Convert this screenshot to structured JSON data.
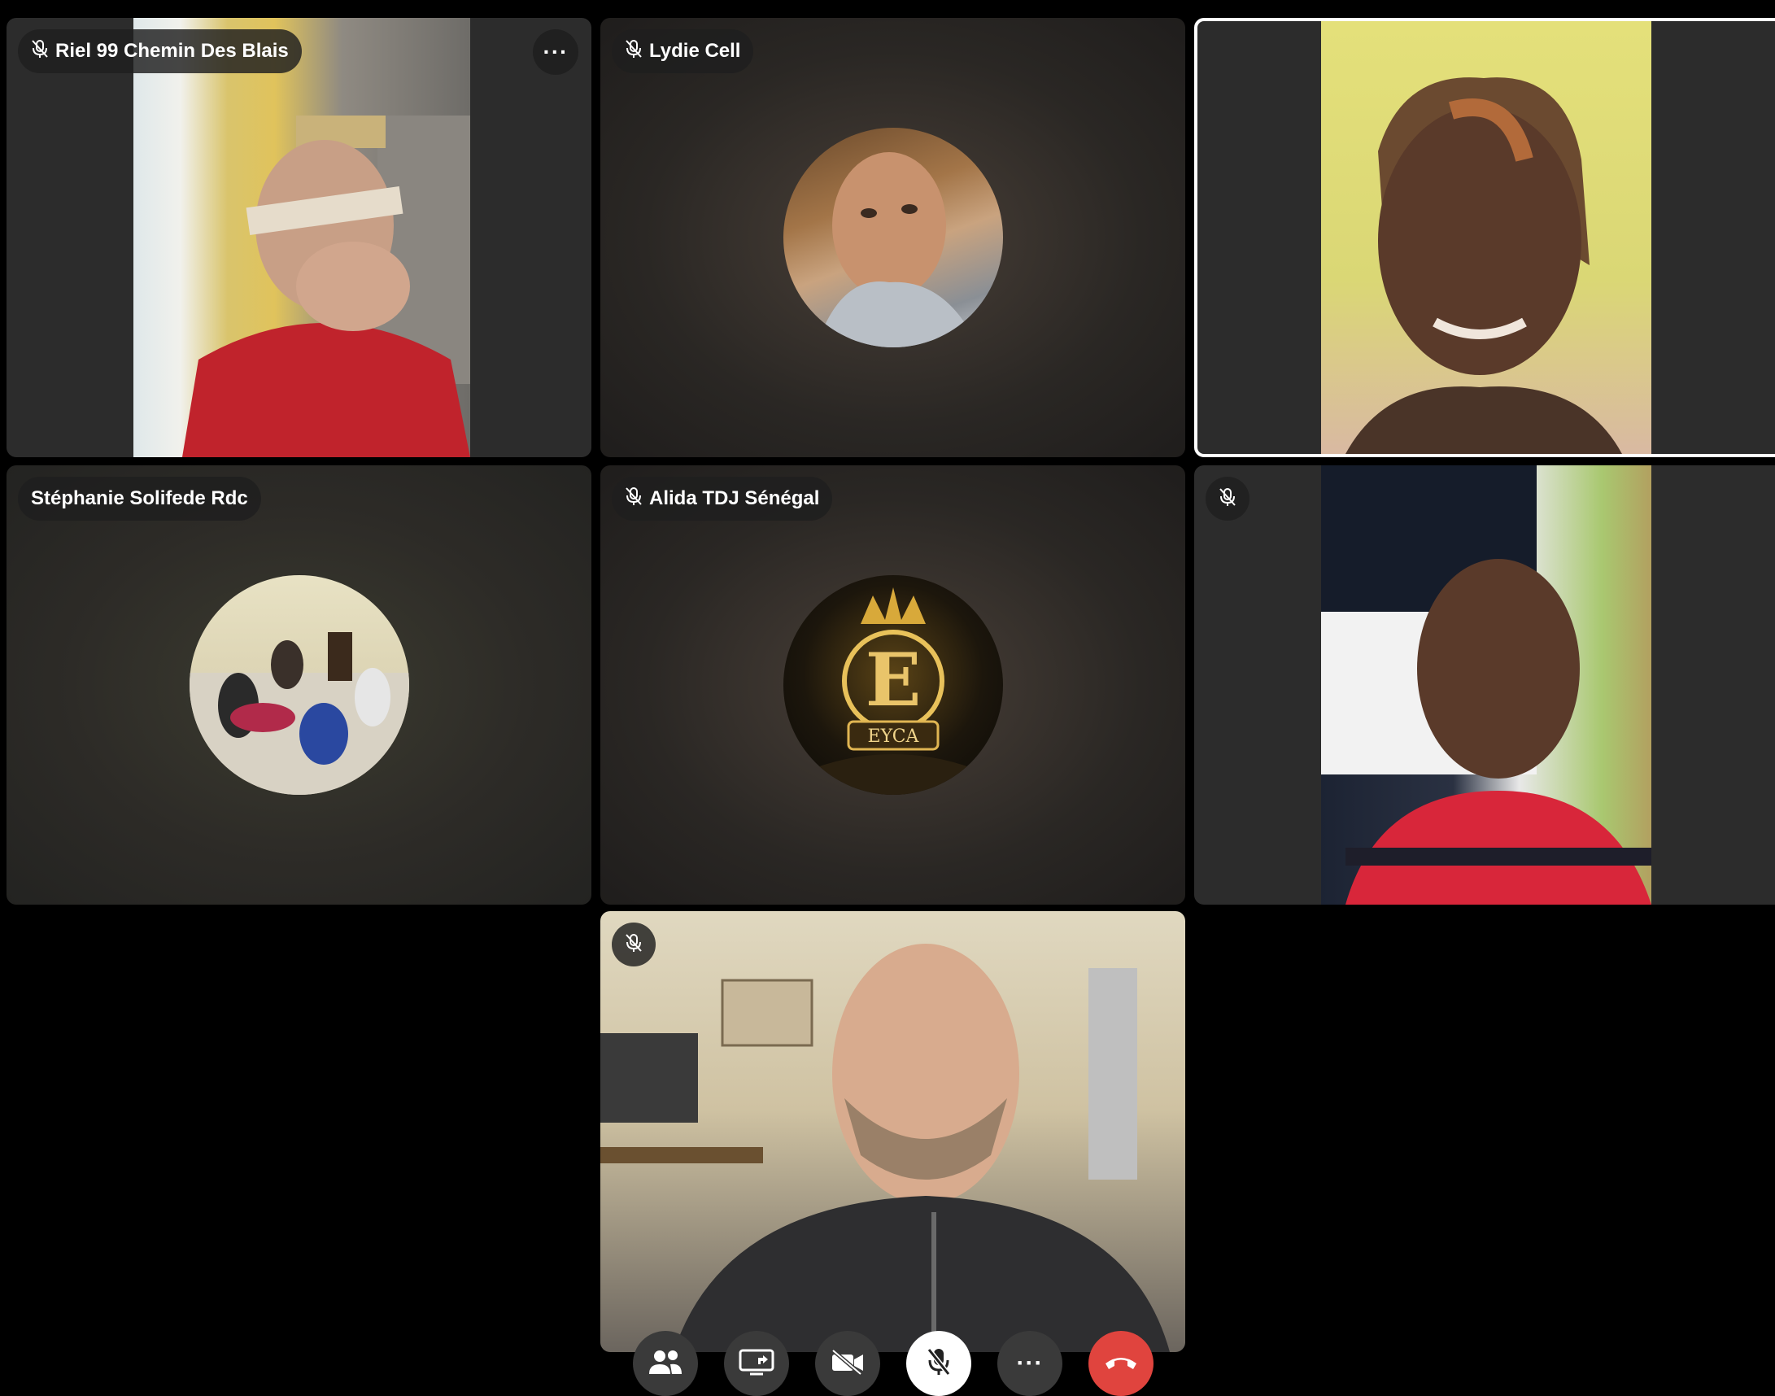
{
  "participants": {
    "p1": {
      "name": "Riel 99 Chemin Des Blais",
      "muted": true
    },
    "p2": {
      "name": "Lydie Cell",
      "muted": true
    },
    "p3": {
      "name": "",
      "speaking": true
    },
    "p4": {
      "name": "Stéphanie Solifede Rdc",
      "muted": false
    },
    "p5": {
      "name": "Alida TDJ Sénégal",
      "muted": true
    },
    "p6": {
      "name": "",
      "muted": true
    },
    "self": {
      "name": "",
      "muted": true
    }
  },
  "tile_menu": {
    "label": "···"
  },
  "avatar_logo": {
    "text": "EYCA",
    "letter": "E"
  },
  "toolbar": {
    "more_label": "···"
  },
  "colors": {
    "background": "#000000",
    "tile": "#2c2c2c",
    "end_call": "#e0443e",
    "speaking_border": "#ffffff"
  }
}
